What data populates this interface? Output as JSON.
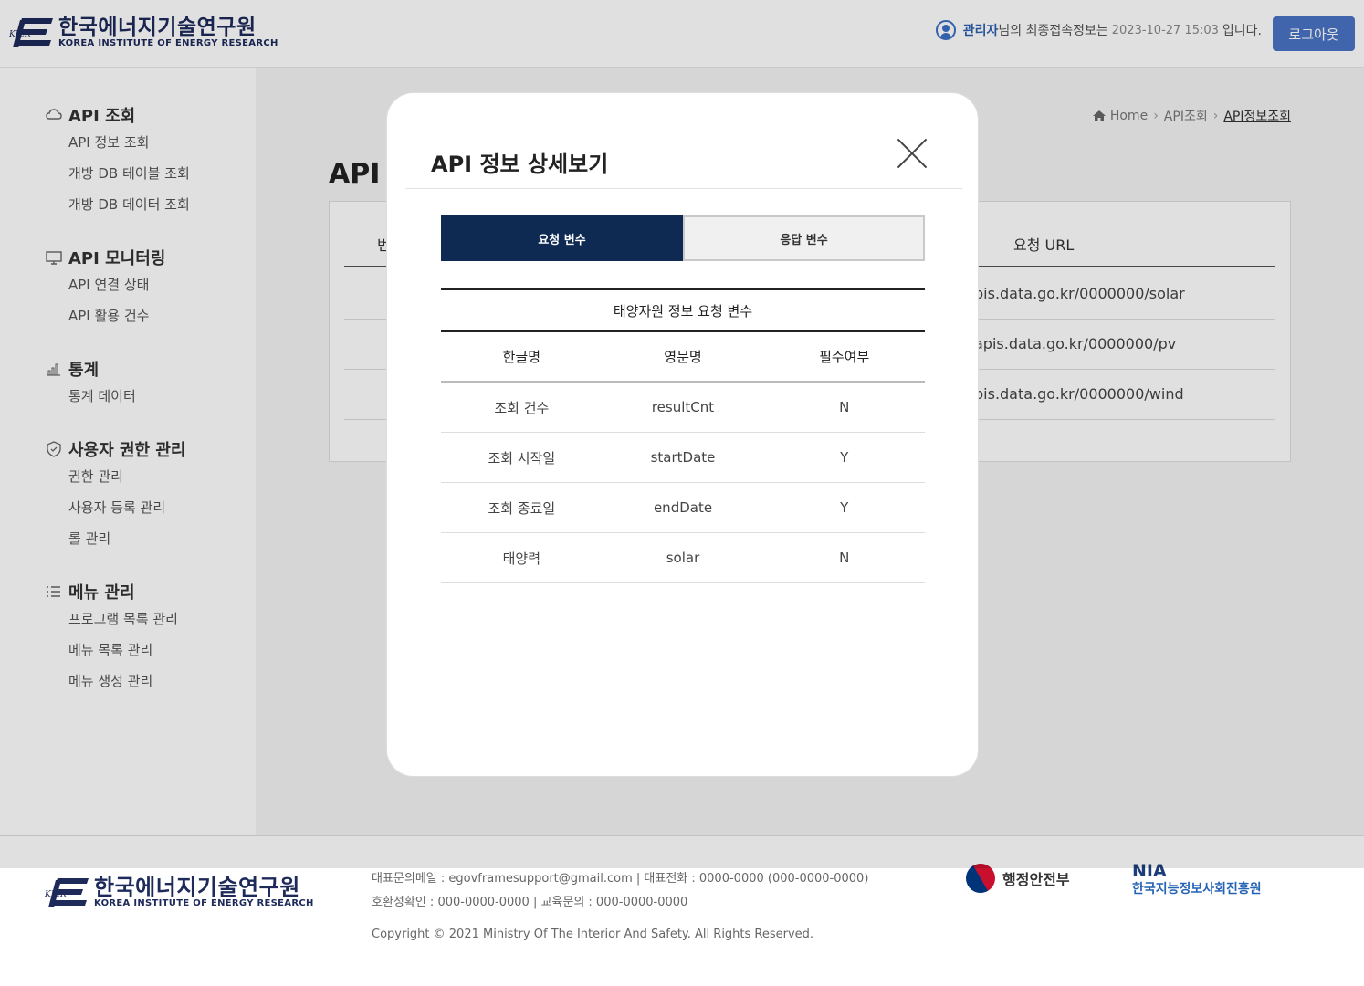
{
  "header": {
    "logo_ko": "한국에너지기술연구원",
    "logo_en": "KOREA INSTITUTE OF ENERGY RESEARCH",
    "logo_mark": "KIER",
    "user_name": "관리자",
    "user_suffix": "님",
    "user_text": "의 최종접속정보는",
    "last_login": "2023-10-27 15:03",
    "user_text_end": "입니다.",
    "logout_label": "로그아웃"
  },
  "sidebar": {
    "groups": [
      {
        "title": "API 조회",
        "icon": "cloud-icon",
        "items": [
          "API 정보 조회",
          "개방 DB 테이블 조회",
          "개방 DB 데이터 조회"
        ]
      },
      {
        "title": "API 모니터링",
        "icon": "monitor-icon",
        "items": [
          "API 연결 상태",
          "API 활용 건수"
        ]
      },
      {
        "title": "통계",
        "icon": "bar-chart-icon",
        "items": [
          "통계 데이터"
        ]
      },
      {
        "title": "사용자 권한 관리",
        "icon": "shield-icon",
        "items": [
          "권한 관리",
          "사용자 등록 관리",
          "롤 관리"
        ]
      },
      {
        "title": "메뉴 관리",
        "icon": "list-icon",
        "items": [
          "프로그램 목록 관리",
          "메뉴 목록 관리",
          "메뉴 생성 관리"
        ]
      }
    ]
  },
  "breadcrumb": {
    "home": "Home",
    "level1": "API조회",
    "current": "API정보조회"
  },
  "page": {
    "title": "API",
    "table_header_left": "번",
    "table_header_url": "요청 URL",
    "rows": [
      "pis.data.go.kr/0000000/solar",
      "apis.data.go.kr/0000000/pv",
      "pis.data.go.kr/0000000/wind"
    ]
  },
  "modal": {
    "title": "API 정보 상세보기",
    "tabs": [
      "요청 변수",
      "응답 변수"
    ],
    "table_caption": "태양자원 정보 요청 변수",
    "columns": [
      "한글명",
      "영문명",
      "필수여부"
    ],
    "rows": [
      [
        "조회 건수",
        "resultCnt",
        "N"
      ],
      [
        "조회 시작일",
        "startDate",
        "Y"
      ],
      [
        "조회 종료일",
        "endDate",
        "Y"
      ],
      [
        "태양력",
        "solar",
        "N"
      ]
    ]
  },
  "footer": {
    "line1": "대표문의메일 : egovframesupport@gmail.com | 대표전화 : 0000-0000 (000-0000-0000)",
    "line2": "호환성확인 : 000-0000-0000 | 교육문의 : 000-0000-0000",
    "copyright": "Copyright © 2021 Ministry Of The Interior And Safety. All Rights Reserved.",
    "gov_name": "행정안전부",
    "nia_top": "NIA",
    "nia_bottom": "한국지능정보사회진흥원"
  }
}
